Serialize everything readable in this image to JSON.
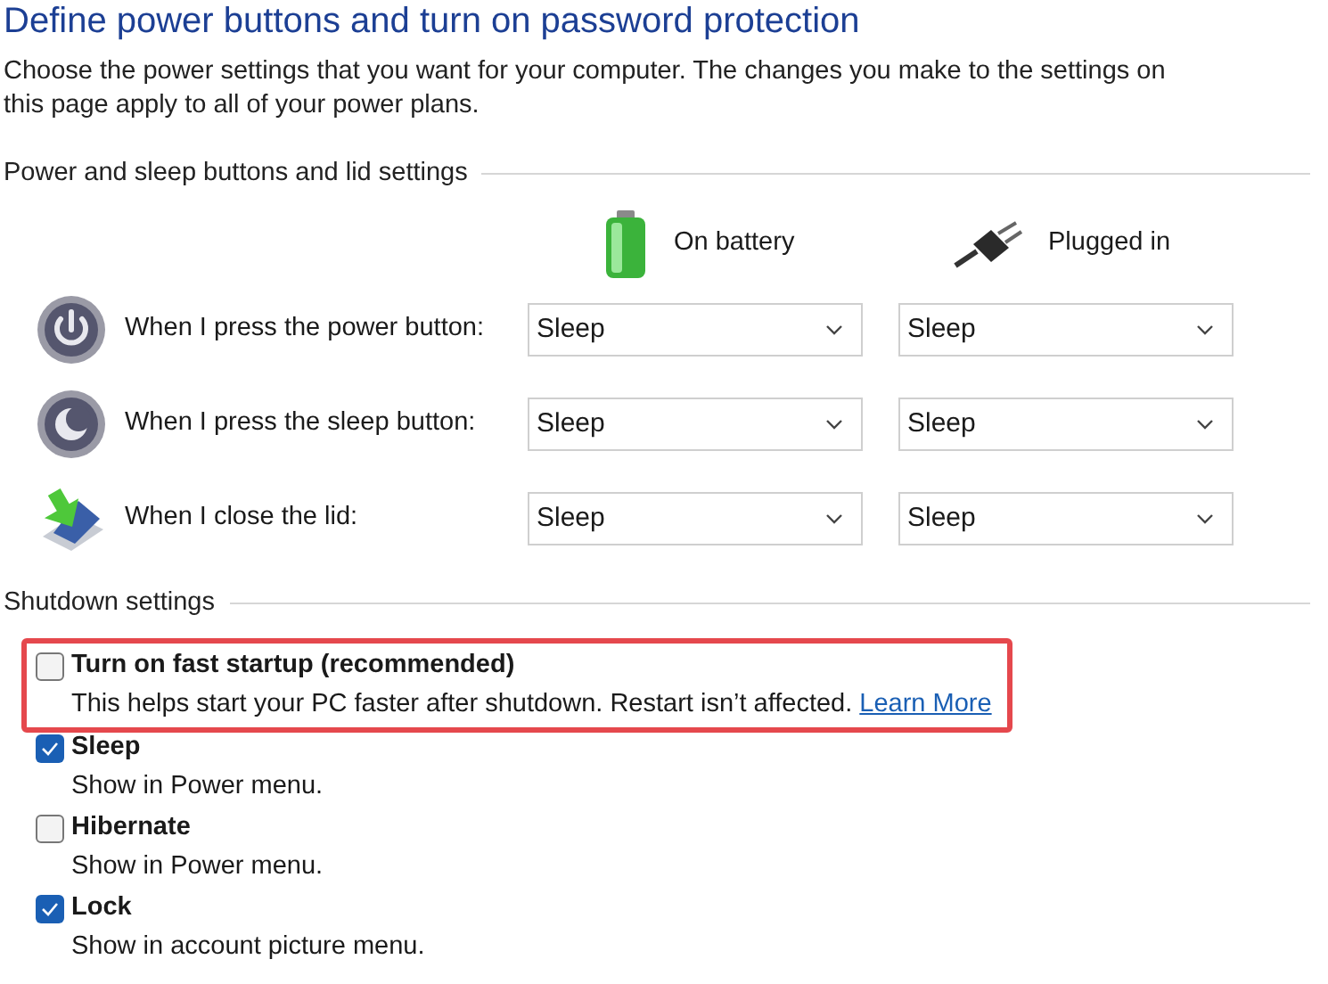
{
  "title": "Define power buttons and turn on password protection",
  "description": "Choose the power settings that you want for your computer. The changes you make to the settings on this page apply to all of your power plans.",
  "power_section": {
    "heading": "Power and sleep buttons and lid settings",
    "columns": [
      {
        "kind": "battery",
        "label": "On battery"
      },
      {
        "kind": "plug",
        "label": "Plugged in"
      }
    ],
    "rows": [
      {
        "kind": "power",
        "label": "When I press the power button:",
        "on_battery": "Sleep",
        "plugged_in": "Sleep"
      },
      {
        "kind": "sleep",
        "label": "When I press the sleep button:",
        "on_battery": "Sleep",
        "plugged_in": "Sleep"
      },
      {
        "kind": "lid",
        "label": "When I close the lid:",
        "on_battery": "Sleep",
        "plugged_in": "Sleep"
      }
    ]
  },
  "shutdown_section": {
    "heading": "Shutdown settings",
    "options": [
      {
        "title": "Turn on fast startup (recommended)",
        "description": "This helps start your PC faster after shutdown. Restart isn’t affected.",
        "link": "Learn More",
        "checked": false,
        "highlighted": true
      },
      {
        "title": "Sleep",
        "description": "Show in Power menu.",
        "checked": true,
        "highlighted": false
      },
      {
        "title": "Hibernate",
        "description": "Show in Power menu.",
        "checked": false,
        "highlighted": false
      },
      {
        "title": "Lock",
        "description": "Show in account picture menu.",
        "checked": true,
        "highlighted": false
      }
    ]
  }
}
